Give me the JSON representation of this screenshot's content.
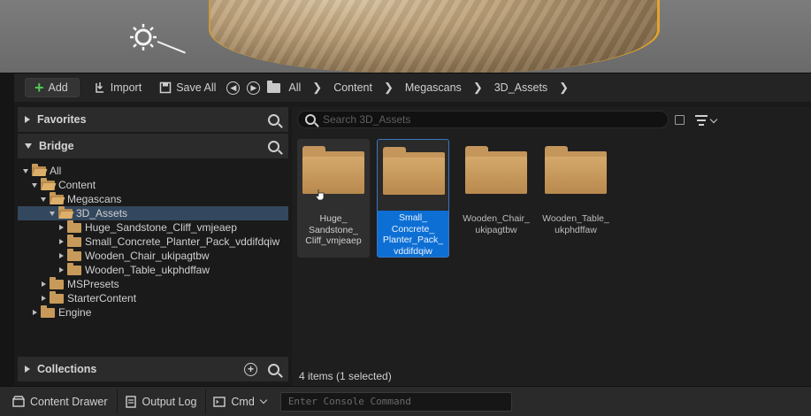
{
  "toolbar": {
    "add_label": "Add",
    "import_label": "Import",
    "saveall_label": "Save All",
    "breadcrumb": [
      "All",
      "Content",
      "Megascans",
      "3D_Assets"
    ]
  },
  "sidebar": {
    "favorites_label": "Favorites",
    "bridge_label": "Bridge",
    "collections_label": "Collections",
    "tree": [
      {
        "label": "All",
        "depth": 0,
        "expanded": true,
        "selected": false
      },
      {
        "label": "Content",
        "depth": 1,
        "expanded": true,
        "selected": false
      },
      {
        "label": "Megascans",
        "depth": 2,
        "expanded": true,
        "selected": false
      },
      {
        "label": "3D_Assets",
        "depth": 3,
        "expanded": true,
        "selected": true
      },
      {
        "label": "Huge_Sandstone_Cliff_vmjeaep",
        "depth": 4,
        "expanded": false,
        "selected": false
      },
      {
        "label": "Small_Concrete_Planter_Pack_vddifdqiw",
        "depth": 4,
        "expanded": false,
        "selected": false
      },
      {
        "label": "Wooden_Chair_ukipagtbw",
        "depth": 4,
        "expanded": false,
        "selected": false
      },
      {
        "label": "Wooden_Table_ukphdffaw",
        "depth": 4,
        "expanded": false,
        "selected": false
      },
      {
        "label": "MSPresets",
        "depth": 2,
        "expanded": false,
        "selected": false
      },
      {
        "label": "StarterContent",
        "depth": 2,
        "expanded": false,
        "selected": false
      },
      {
        "label": "Engine",
        "depth": 1,
        "expanded": false,
        "selected": false
      }
    ]
  },
  "content": {
    "search_placeholder": "Search 3D_Assets",
    "items": [
      {
        "label": "Huge_\nSandstone_\nCliff_vmjeaep",
        "state": "hover"
      },
      {
        "label": "Small_\nConcrete_\nPlanter_Pack_\nvddifdqiw",
        "state": "selected"
      },
      {
        "label": "Wooden_Chair_\nukipagtbw",
        "state": "normal"
      },
      {
        "label": "Wooden_Table_\nukphdffaw",
        "state": "normal"
      }
    ],
    "status": "4 items (1 selected)"
  },
  "bottom": {
    "content_drawer_label": "Content Drawer",
    "output_log_label": "Output Log",
    "cmd_label": "Cmd",
    "console_placeholder": "Enter Console Command"
  },
  "colors": {
    "folder": "#c4965b",
    "selection": "#0d6fd4",
    "add_green": "#4fc84f"
  }
}
